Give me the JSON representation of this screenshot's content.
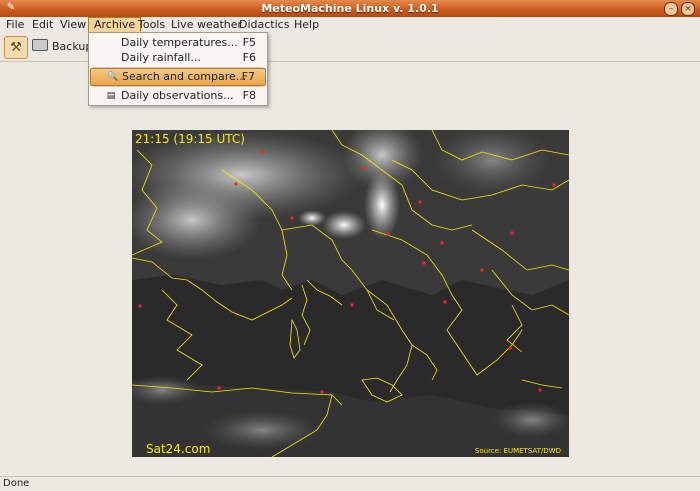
{
  "window": {
    "title": "MeteoMachine Linux v. 1.0.1"
  },
  "menubar": {
    "items": [
      {
        "label": "File"
      },
      {
        "label": "Edit"
      },
      {
        "label": "View"
      },
      {
        "label": "Archive"
      },
      {
        "label": "Tools"
      },
      {
        "label": "Live weather"
      },
      {
        "label": "Didactics"
      },
      {
        "label": "Help"
      }
    ],
    "active": "Archive"
  },
  "toolbar": {
    "backup_label": "Backup"
  },
  "archive_menu": {
    "items": [
      {
        "label": "Daily temperatures...",
        "shortcut": "F5",
        "icon": "none"
      },
      {
        "label": "Daily rainfall...",
        "shortcut": "F6",
        "icon": "none"
      },
      {
        "label": "Search and compare...",
        "shortcut": "F7",
        "icon": "search-compare-icon",
        "highlighted": true
      },
      {
        "label": "Daily observations...",
        "shortcut": "F8",
        "icon": "document-icon"
      }
    ]
  },
  "satellite": {
    "time_label": "21:15 (19:15 UTC)",
    "brand": "Sat24.com",
    "source": "Source: EUMETSAT/DWD"
  },
  "status": {
    "text": "Done"
  },
  "colors": {
    "title_bar": "#c85a1c",
    "menu_highlight": "#e9a64a",
    "map_lines": "#ffe800",
    "city_dots": "#ff2020"
  }
}
